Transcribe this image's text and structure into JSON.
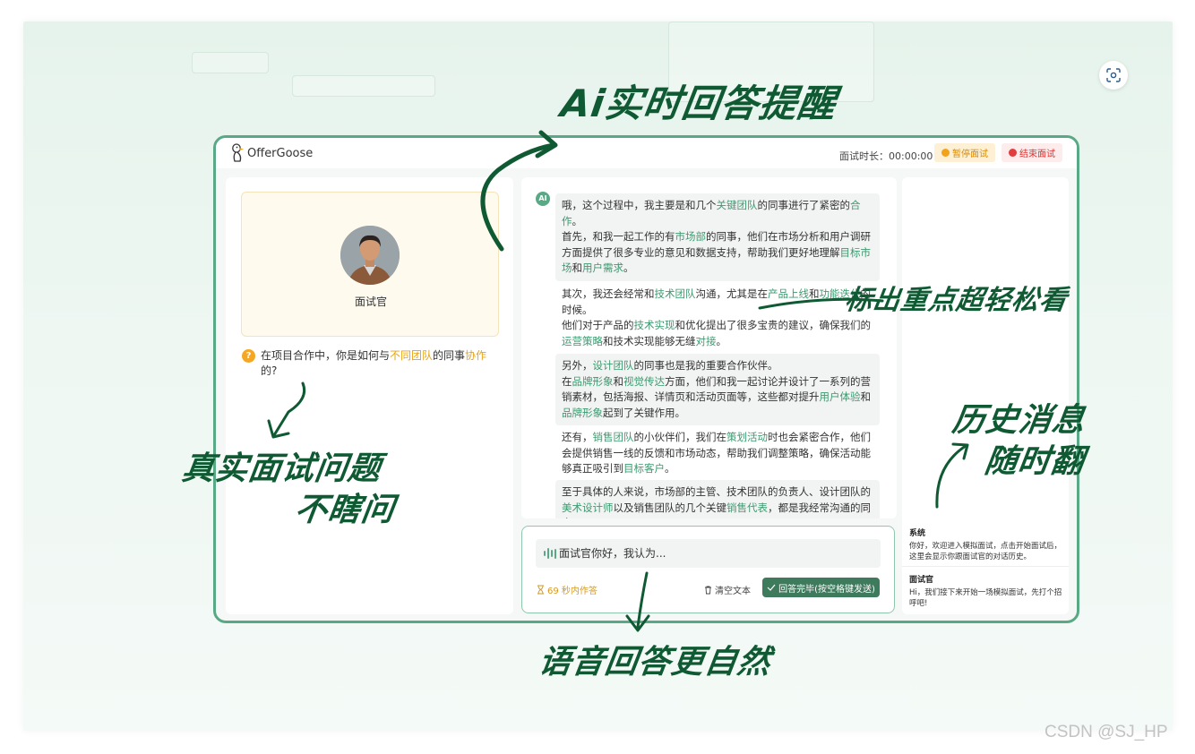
{
  "app": {
    "logo_text": "OfferGoose"
  },
  "header": {
    "timer_label": "面试时长：00:00:00",
    "pause_label": "暂停面试",
    "end_label": "结束面试"
  },
  "interviewer": {
    "label": "面试官",
    "question_parts": [
      "在项目合作中，你是如何与",
      "不同团队",
      "的同事",
      "协作",
      "的?"
    ]
  },
  "chat": {
    "ai_badge": "AI",
    "messages": [
      {
        "parts": [
          {
            "t": "哦，这个过程中，我主要是和几个"
          },
          {
            "t": "关键团队",
            "h": true
          },
          {
            "t": "的同事进行了紧密的"
          },
          {
            "t": "合作",
            "h": true
          },
          {
            "t": "。"
          },
          {
            "br": true
          },
          {
            "t": "首先，和我一起工作的有"
          },
          {
            "t": "市场部",
            "h": true
          },
          {
            "t": "的同事，他们在市场分析和用户调研方面提供了很多专业的意见和数据支持，帮助我们更好地理解"
          },
          {
            "t": "目标市场",
            "h": true
          },
          {
            "t": "和"
          },
          {
            "t": "用户需求",
            "h": true
          },
          {
            "t": "。"
          }
        ]
      },
      {
        "parts": [
          {
            "t": "其次，我还会经常和"
          },
          {
            "t": "技术团队",
            "h": true
          },
          {
            "t": "沟通，尤其是在"
          },
          {
            "t": "产品上线",
            "h": true
          },
          {
            "t": "和"
          },
          {
            "t": "功能迭代",
            "h": true
          },
          {
            "t": "的时候。"
          },
          {
            "br": true
          },
          {
            "t": "他们对于产品的"
          },
          {
            "t": "技术实现",
            "h": true
          },
          {
            "t": "和优化提出了很多宝贵的建议，确保我们的"
          },
          {
            "t": "运营策略",
            "h": true
          },
          {
            "t": "和技术实现能够无缝"
          },
          {
            "t": "对接",
            "h": true
          },
          {
            "t": "。"
          }
        ]
      },
      {
        "parts": [
          {
            "t": "另外，"
          },
          {
            "t": "设计团队",
            "h": true
          },
          {
            "t": "的同事也是我的重要合作伙伴。"
          },
          {
            "br": true
          },
          {
            "t": "在"
          },
          {
            "t": "品牌形象",
            "h": true
          },
          {
            "t": "和"
          },
          {
            "t": "视觉传达",
            "h": true
          },
          {
            "t": "方面，他们和我一起讨论并设计了一系列的营销素材，包括海报、详情页和活动页面等，这些都对提升"
          },
          {
            "t": "用户体验",
            "h": true
          },
          {
            "t": "和"
          },
          {
            "t": "品牌形象",
            "h": true
          },
          {
            "t": "起到了关键作用。"
          }
        ]
      },
      {
        "parts": [
          {
            "t": "还有，"
          },
          {
            "t": "销售团队",
            "h": true
          },
          {
            "t": "的小伙伴们，我们在"
          },
          {
            "t": "策划活动",
            "h": true
          },
          {
            "t": "时也会紧密合作，他们会提供销售一线的反馈和市场动态，帮助我们调整策略，确保活动能够真正吸引到"
          },
          {
            "t": "目标客户",
            "h": true
          },
          {
            "t": "。"
          }
        ]
      },
      {
        "parts": [
          {
            "t": "至于具体的人来说，市场部的主管、技术团队的负责人、设计团队的"
          },
          {
            "t": "美术设计师",
            "h": true
          },
          {
            "t": "以及销售团队的几个关键"
          },
          {
            "t": "销售代表",
            "h": true
          },
          {
            "t": "，都是我经常沟通的同事。"
          }
        ]
      }
    ]
  },
  "input": {
    "text": "面试官你好，我认为...",
    "countdown": "69 秒内作答",
    "clear_label": "清空文本",
    "send_label": "回答完毕(按空格键发送)"
  },
  "history": [
    {
      "who": "系统",
      "text": "你好，欢迎进入模拟面试，点击开始面试后，这里会显示你跟面试官的对话历史。"
    },
    {
      "who": "面试官",
      "text": "Hi，我们接下来开始一场模拟面试，先打个招呼吧!"
    }
  ],
  "annotations": {
    "top": "Ai实时回答提醒",
    "right_mid": "标出重点超轻松看",
    "left_1": "真实面试问题",
    "left_2": "不瞎问",
    "right_1": "历史消息",
    "right_2": "随时翻",
    "bottom": "语音回答更自然"
  },
  "watermark": "CSDN @SJ_HP",
  "colors": {
    "accent_green": "#5aa986",
    "highlight_green": "#3d9a70",
    "highlight_orange": "#e6a417",
    "send_button": "#3e7a5c",
    "annotation_ink": "#0f5a33"
  }
}
